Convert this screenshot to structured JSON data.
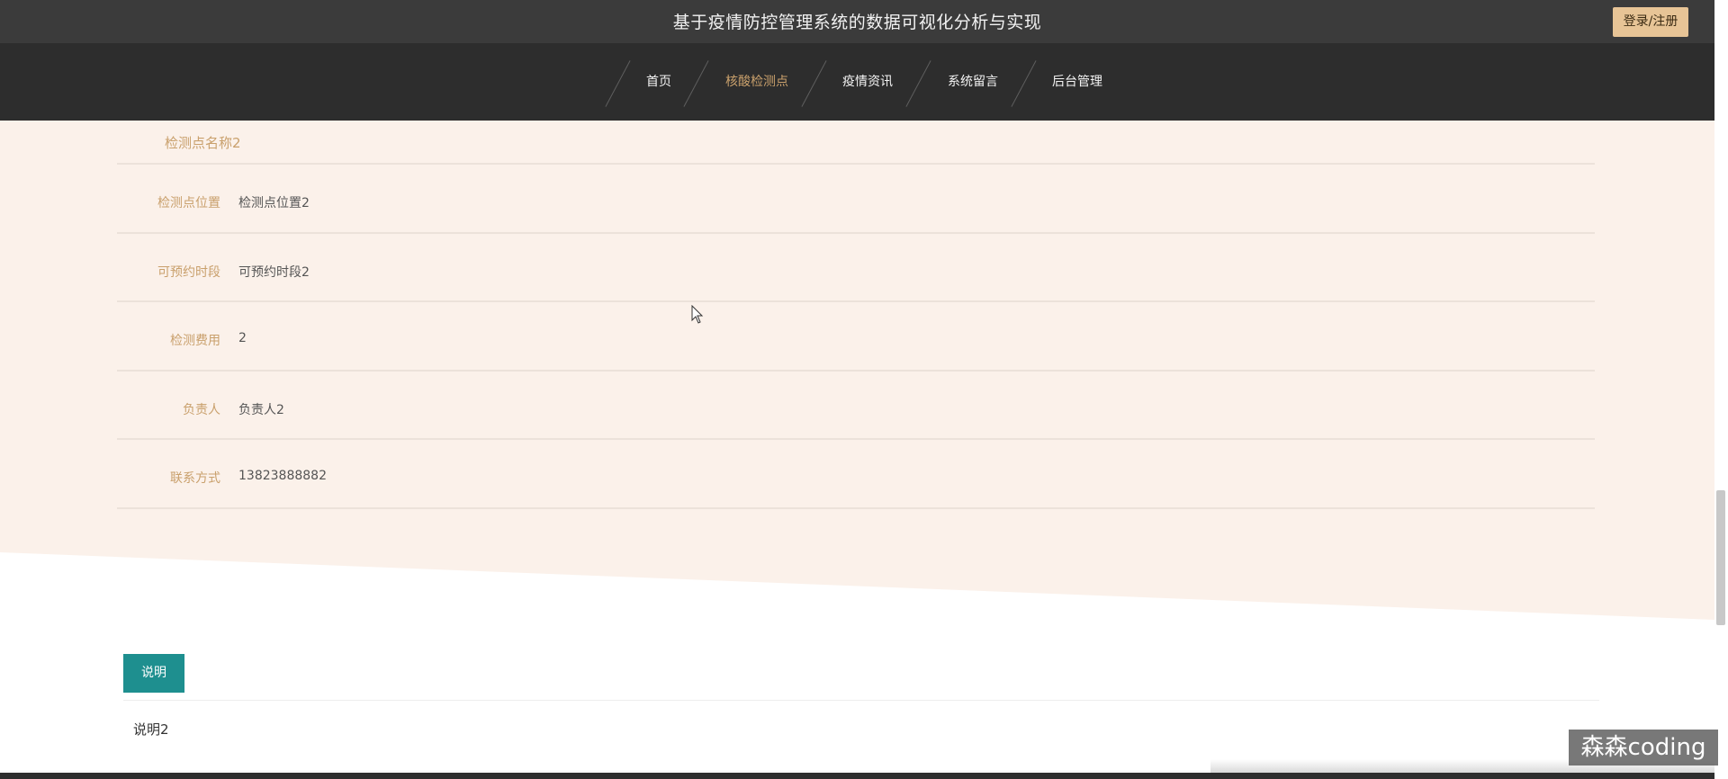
{
  "header": {
    "site_title": "基于疫情防控管理系统的数据可视化分析与实现",
    "login_label": "登录/注册"
  },
  "nav": {
    "items": [
      {
        "label": "首页",
        "active": false
      },
      {
        "label": "核酸检测点",
        "active": true
      },
      {
        "label": "疫情资讯",
        "active": false
      },
      {
        "label": "系统留言",
        "active": false
      },
      {
        "label": "后台管理",
        "active": false
      }
    ]
  },
  "detail": {
    "name": "检测点名称2",
    "fields": [
      {
        "label": "检测点位置",
        "value": "检测点位置2"
      },
      {
        "label": "可预约时段",
        "value": "可预约时段2"
      },
      {
        "label": "检测费用",
        "value": "2"
      },
      {
        "label": "负责人",
        "value": "负责人2"
      },
      {
        "label": "联系方式",
        "value": "13823888882"
      }
    ]
  },
  "description": {
    "tab_label": "说明",
    "text": "说明2"
  },
  "watermark": "森森coding",
  "colors": {
    "header_bg": "#3b3b3b",
    "nav_bg": "#2d2d2d",
    "accent_gold": "#c9a06c",
    "login_bg": "#e7c496",
    "detail_bg": "#fbf1ea",
    "tab_teal": "#1e8f8f"
  }
}
